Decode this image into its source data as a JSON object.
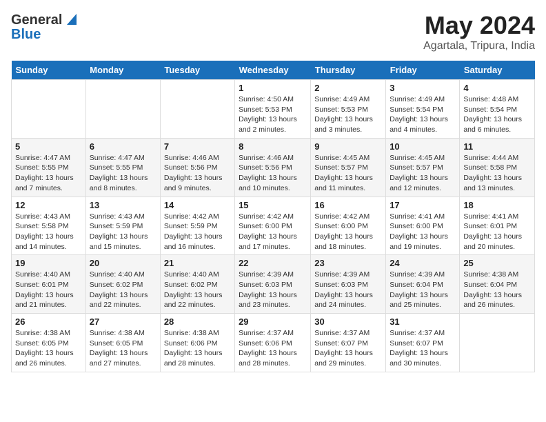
{
  "header": {
    "logo_general": "General",
    "logo_blue": "Blue",
    "month_title": "May 2024",
    "location": "Agartala, Tripura, India"
  },
  "weekdays": [
    "Sunday",
    "Monday",
    "Tuesday",
    "Wednesday",
    "Thursday",
    "Friday",
    "Saturday"
  ],
  "weeks": [
    [
      {
        "day": "",
        "detail": ""
      },
      {
        "day": "",
        "detail": ""
      },
      {
        "day": "",
        "detail": ""
      },
      {
        "day": "1",
        "detail": "Sunrise: 4:50 AM\nSunset: 5:53 PM\nDaylight: 13 hours and 2 minutes."
      },
      {
        "day": "2",
        "detail": "Sunrise: 4:49 AM\nSunset: 5:53 PM\nDaylight: 13 hours and 3 minutes."
      },
      {
        "day": "3",
        "detail": "Sunrise: 4:49 AM\nSunset: 5:54 PM\nDaylight: 13 hours and 4 minutes."
      },
      {
        "day": "4",
        "detail": "Sunrise: 4:48 AM\nSunset: 5:54 PM\nDaylight: 13 hours and 6 minutes."
      }
    ],
    [
      {
        "day": "5",
        "detail": "Sunrise: 4:47 AM\nSunset: 5:55 PM\nDaylight: 13 hours and 7 minutes."
      },
      {
        "day": "6",
        "detail": "Sunrise: 4:47 AM\nSunset: 5:55 PM\nDaylight: 13 hours and 8 minutes."
      },
      {
        "day": "7",
        "detail": "Sunrise: 4:46 AM\nSunset: 5:56 PM\nDaylight: 13 hours and 9 minutes."
      },
      {
        "day": "8",
        "detail": "Sunrise: 4:46 AM\nSunset: 5:56 PM\nDaylight: 13 hours and 10 minutes."
      },
      {
        "day": "9",
        "detail": "Sunrise: 4:45 AM\nSunset: 5:57 PM\nDaylight: 13 hours and 11 minutes."
      },
      {
        "day": "10",
        "detail": "Sunrise: 4:45 AM\nSunset: 5:57 PM\nDaylight: 13 hours and 12 minutes."
      },
      {
        "day": "11",
        "detail": "Sunrise: 4:44 AM\nSunset: 5:58 PM\nDaylight: 13 hours and 13 minutes."
      }
    ],
    [
      {
        "day": "12",
        "detail": "Sunrise: 4:43 AM\nSunset: 5:58 PM\nDaylight: 13 hours and 14 minutes."
      },
      {
        "day": "13",
        "detail": "Sunrise: 4:43 AM\nSunset: 5:59 PM\nDaylight: 13 hours and 15 minutes."
      },
      {
        "day": "14",
        "detail": "Sunrise: 4:42 AM\nSunset: 5:59 PM\nDaylight: 13 hours and 16 minutes."
      },
      {
        "day": "15",
        "detail": "Sunrise: 4:42 AM\nSunset: 6:00 PM\nDaylight: 13 hours and 17 minutes."
      },
      {
        "day": "16",
        "detail": "Sunrise: 4:42 AM\nSunset: 6:00 PM\nDaylight: 13 hours and 18 minutes."
      },
      {
        "day": "17",
        "detail": "Sunrise: 4:41 AM\nSunset: 6:00 PM\nDaylight: 13 hours and 19 minutes."
      },
      {
        "day": "18",
        "detail": "Sunrise: 4:41 AM\nSunset: 6:01 PM\nDaylight: 13 hours and 20 minutes."
      }
    ],
    [
      {
        "day": "19",
        "detail": "Sunrise: 4:40 AM\nSunset: 6:01 PM\nDaylight: 13 hours and 21 minutes."
      },
      {
        "day": "20",
        "detail": "Sunrise: 4:40 AM\nSunset: 6:02 PM\nDaylight: 13 hours and 22 minutes."
      },
      {
        "day": "21",
        "detail": "Sunrise: 4:40 AM\nSunset: 6:02 PM\nDaylight: 13 hours and 22 minutes."
      },
      {
        "day": "22",
        "detail": "Sunrise: 4:39 AM\nSunset: 6:03 PM\nDaylight: 13 hours and 23 minutes."
      },
      {
        "day": "23",
        "detail": "Sunrise: 4:39 AM\nSunset: 6:03 PM\nDaylight: 13 hours and 24 minutes."
      },
      {
        "day": "24",
        "detail": "Sunrise: 4:39 AM\nSunset: 6:04 PM\nDaylight: 13 hours and 25 minutes."
      },
      {
        "day": "25",
        "detail": "Sunrise: 4:38 AM\nSunset: 6:04 PM\nDaylight: 13 hours and 26 minutes."
      }
    ],
    [
      {
        "day": "26",
        "detail": "Sunrise: 4:38 AM\nSunset: 6:05 PM\nDaylight: 13 hours and 26 minutes."
      },
      {
        "day": "27",
        "detail": "Sunrise: 4:38 AM\nSunset: 6:05 PM\nDaylight: 13 hours and 27 minutes."
      },
      {
        "day": "28",
        "detail": "Sunrise: 4:38 AM\nSunset: 6:06 PM\nDaylight: 13 hours and 28 minutes."
      },
      {
        "day": "29",
        "detail": "Sunrise: 4:37 AM\nSunset: 6:06 PM\nDaylight: 13 hours and 28 minutes."
      },
      {
        "day": "30",
        "detail": "Sunrise: 4:37 AM\nSunset: 6:07 PM\nDaylight: 13 hours and 29 minutes."
      },
      {
        "day": "31",
        "detail": "Sunrise: 4:37 AM\nSunset: 6:07 PM\nDaylight: 13 hours and 30 minutes."
      },
      {
        "day": "",
        "detail": ""
      }
    ]
  ]
}
